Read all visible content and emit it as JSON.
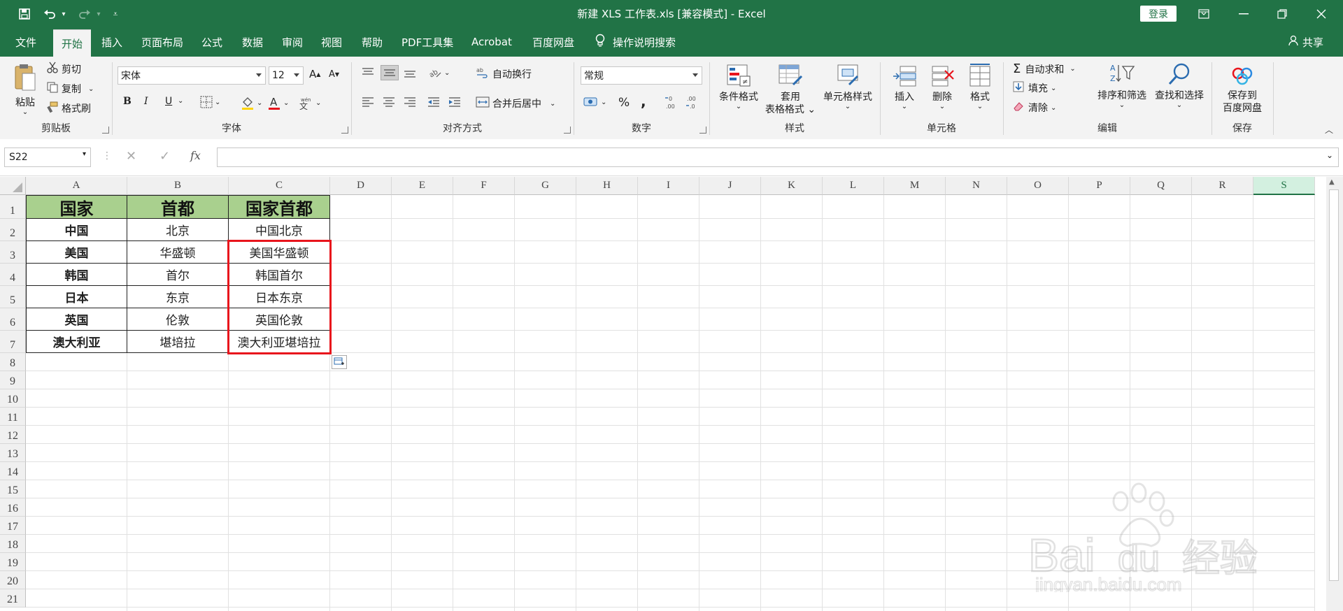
{
  "app": {
    "title": "新建 XLS 工作表.xls  [兼容模式]  -  Excel",
    "login": "登录",
    "share": "共享"
  },
  "tabs": [
    "文件",
    "开始",
    "插入",
    "页面布局",
    "公式",
    "数据",
    "审阅",
    "视图",
    "帮助",
    "PDF工具集",
    "Acrobat",
    "百度网盘",
    "操作说明搜索"
  ],
  "ribbon": {
    "clipboard": {
      "paste": "粘贴",
      "cut": "剪切",
      "copy": "复制",
      "format_painter": "格式刷",
      "label": "剪贴板"
    },
    "font": {
      "family": "宋体",
      "size": "12",
      "bold": "B",
      "italic": "I",
      "underline": "U",
      "label": "字体"
    },
    "alignment": {
      "wrap": "自动换行",
      "merge": "合并后居中",
      "label": "对齐方式"
    },
    "number": {
      "format": "常规",
      "percent": "%",
      "comma": ",",
      "label": "数字"
    },
    "styles": {
      "conditional": "条件格式",
      "table_l1": "套用",
      "table_l2": "表格格式",
      "cell_styles": "单元格样式",
      "label": "样式"
    },
    "cells": {
      "insert": "插入",
      "delete": "删除",
      "format": "格式",
      "label": "单元格"
    },
    "editing": {
      "autosum": "自动求和",
      "fill": "填充",
      "clear": "清除",
      "sort_filter": "排序和筛选",
      "find_select": "查找和选择",
      "label": "编辑"
    },
    "save": {
      "line1": "保存到",
      "line2": "百度网盘",
      "label": "保存"
    }
  },
  "formula_bar": {
    "name_box": "S22",
    "fx": "fx",
    "value": ""
  },
  "sheet": {
    "columns": [
      "A",
      "B",
      "C",
      "D",
      "E",
      "F",
      "G",
      "H",
      "I",
      "J",
      "K",
      "L",
      "M",
      "N",
      "O",
      "P",
      "Q",
      "R",
      "S"
    ],
    "selected_column": "S",
    "rows": [
      "1",
      "2",
      "3",
      "4",
      "5",
      "6",
      "7",
      "8",
      "9",
      "10",
      "11",
      "12",
      "13",
      "14",
      "15",
      "16",
      "17",
      "18",
      "19",
      "20",
      "21"
    ],
    "table": [
      [
        "国家",
        "首都",
        "国家首都"
      ],
      [
        "中国",
        "北京",
        "中国北京"
      ],
      [
        "美国",
        "华盛顿",
        "美国华盛顿"
      ],
      [
        "韩国",
        "首尔",
        "韩国首尔"
      ],
      [
        "日本",
        "东京",
        "日本东京"
      ],
      [
        "英国",
        "伦敦",
        "英国伦敦"
      ],
      [
        "澳大利亚",
        "堪培拉",
        "澳大利亚堪培拉"
      ]
    ],
    "header_fill": "#a9d08e",
    "highlight_color": "#e8141c"
  },
  "watermark": {
    "line1": "Bai",
    "line2": "du",
    "line3": "经验",
    "line4": "jingyan.baidu.com"
  },
  "colors": {
    "accent": "#217346"
  }
}
